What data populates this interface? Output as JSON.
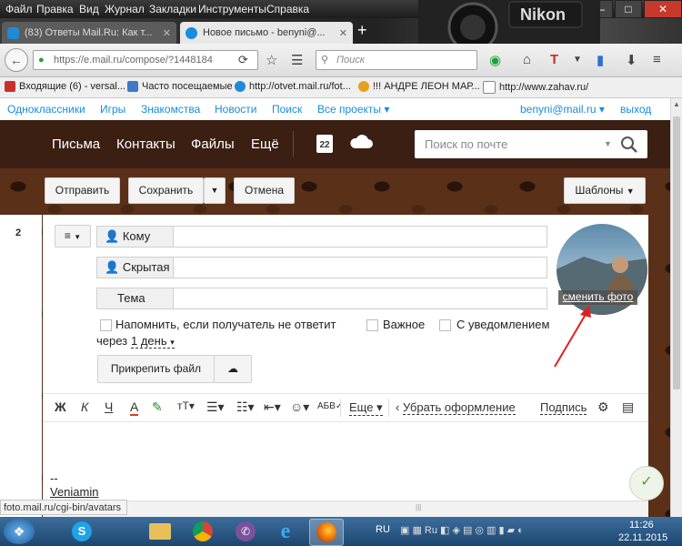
{
  "browser": {
    "menu": [
      "Файл",
      "Правка",
      "Вид",
      "Журнал",
      "Закладки",
      "Инструменты",
      "Справка"
    ],
    "window_controls": {
      "minimize": "—",
      "maximize": "□",
      "close": "✕"
    },
    "tabs": [
      {
        "title": "(83) Ответы Mail.Ru: Как т...",
        "close": "✕"
      },
      {
        "title": "Новое письмо - benyni@...",
        "close": "✕"
      }
    ],
    "new_tab": "+",
    "url": "https://e.mail.ru/compose/?1448184",
    "search_placeholder": "Поиск",
    "bookmarks": [
      "Входящие (6) - versal...",
      "Часто посещаемые",
      "http://otvet.mail.ru/fot...",
      "!!! АНДРЕ ЛЕОН МАР...",
      "http://www.zahav.ru/"
    ],
    "status_url": "foto.mail.ru/cgi-bin/avatars"
  },
  "portal": {
    "links": [
      "Одноклассники",
      "Игры",
      "Знакомства",
      "Новости",
      "Поиск",
      "Все проекты"
    ],
    "user": "benyni@mail.ru",
    "logout": "выход"
  },
  "header": {
    "nav": [
      "Письма",
      "Контакты",
      "Файлы",
      "Ещё"
    ],
    "calendar_day": "22",
    "search_placeholder": "Поиск по почте"
  },
  "toolbar": {
    "send": "Отправить",
    "save": "Сохранить",
    "cancel": "Отмена",
    "templates": "Шаблоны"
  },
  "compose": {
    "side_number": "2",
    "to_label": "Кому",
    "bcc_label": "Скрытая",
    "subject_label": "Тема",
    "remind": "Напомнить, если получатель не ответит",
    "remind_prefix": "через",
    "remind_period": "1 день",
    "important": "Важное",
    "notify": "С уведомлением",
    "attach": "Прикрепить файл",
    "change_photo": "сменить фото",
    "signature_separator": "--",
    "signature_name": "Veniamin"
  },
  "editor": {
    "bold": "Ж",
    "italic": "К",
    "underline": "Ч",
    "color": "А",
    "font_size": "тТ",
    "more": "Еще",
    "remove_format": "Убрать оформление",
    "signature": "Подпись"
  },
  "taskbar": {
    "lang": "RU",
    "time": "11:26",
    "date": "22.11.2015"
  },
  "colors": {
    "link_blue": "#168de2",
    "header_brown": "#3b1f13",
    "arrow_red": "#e02020"
  }
}
